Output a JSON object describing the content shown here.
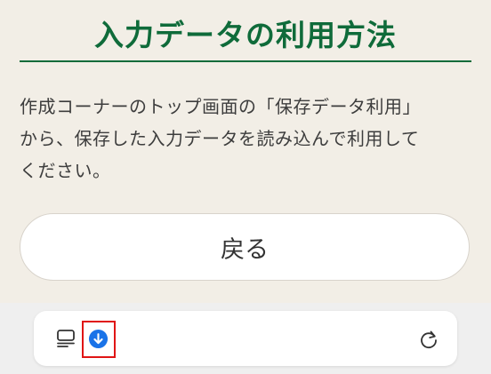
{
  "page": {
    "title": "入力データの利用方法",
    "body_lines": [
      "作成コーナーのトップ画面の「保存データ利用」",
      "から、保存した入力データを読み込んで利用して",
      "ください。"
    ],
    "back_button_label": "戻る"
  },
  "colors": {
    "background": "#f2eee6",
    "title_green": "#0f6b3a",
    "download_blue": "#1a73e8",
    "highlight_red": "#e01515"
  },
  "browser_bar": {
    "icons": [
      "tabs-icon",
      "download-icon",
      "reload-icon"
    ]
  }
}
